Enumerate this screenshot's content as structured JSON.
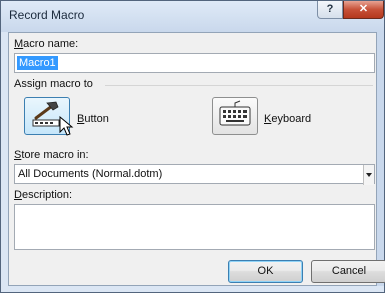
{
  "window": {
    "title": "Record Macro",
    "help_label": "?",
    "close_label": "✕"
  },
  "macro_name": {
    "label_first": "M",
    "label_rest": "acro name:",
    "value": "Macro1"
  },
  "assign": {
    "group_label": "Assign macro to",
    "button_label_first": "B",
    "button_label_rest": "utton",
    "keyboard_label_first": "K",
    "keyboard_label_rest": "eyboard"
  },
  "store": {
    "label_first": "S",
    "label_rest": "tore macro in:",
    "selected": "All Documents (Normal.dotm)"
  },
  "description": {
    "label_first": "D",
    "label_rest": "escription:",
    "value": ""
  },
  "buttons": {
    "ok": "OK",
    "cancel": "Cancel"
  }
}
